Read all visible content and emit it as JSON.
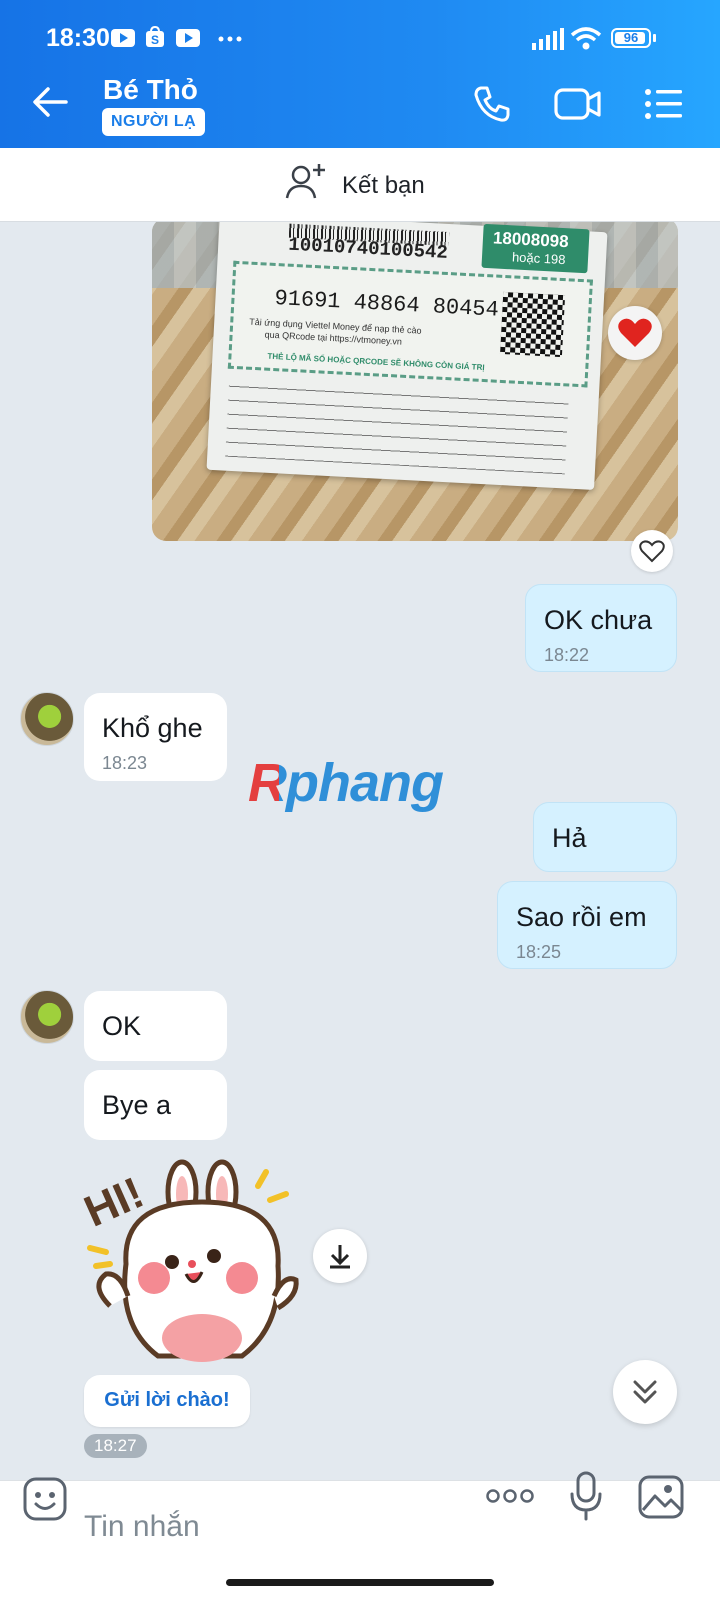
{
  "status_bar": {
    "time": "18:30",
    "battery": "96",
    "icons": [
      "youtube-icon",
      "shopee-icon",
      "youtube-icon",
      "more-dots-icon",
      "signal-icon",
      "wifi-icon",
      "battery-icon"
    ]
  },
  "header": {
    "title": "Bé Thỏ",
    "badge": "NGƯỜI LẠ",
    "icons": [
      "back-arrow-icon",
      "phone-icon",
      "video-call-icon",
      "menu-list-icon"
    ]
  },
  "friend_bar": {
    "label": "Kết bạn",
    "icon": "add-friend-icon"
  },
  "watermark": {
    "text": "Rphang"
  },
  "card_photo": {
    "barcode_number": "10010740100542",
    "hotline": "18008098",
    "hotline_alt": "hoặc 198",
    "code": "91691 48864 80454",
    "app_line": "Tải ứng dụng Viettel Money để nạp thẻ cào",
    "qr_line": "qua QRcode tại https://vtmoney.vn",
    "warning": "THẺ LỘ MÃ SỐ HOẶC QRCODE SẼ KHÔNG CÒN GIÁ TRỊ",
    "reaction": "heart"
  },
  "messages": [
    {
      "side": "me",
      "text": "OK chưa",
      "time": "18:22"
    },
    {
      "side": "them",
      "text": "Khổ ghe",
      "time": "18:23"
    },
    {
      "side": "me",
      "text": "Hả",
      "time": ""
    },
    {
      "side": "me",
      "text": "Sao rồi em",
      "time": "18:25"
    },
    {
      "side": "them",
      "text": "OK",
      "time": ""
    },
    {
      "side": "them",
      "text": "Bye a",
      "time": ""
    }
  ],
  "sticker": {
    "text": "HI!",
    "icon": "bunny-sticker"
  },
  "greeting_button": "Gửi lời chào!",
  "last_time": "18:27",
  "input": {
    "placeholder": "Tin nhắn",
    "icons": [
      "emoji-icon",
      "more-options-icon",
      "microphone-icon",
      "image-icon"
    ]
  },
  "colors": {
    "header_blue": "#1a7ee9",
    "my_bubble": "#d5f1ff",
    "their_bubble": "#ffffff",
    "chat_bg": "#e3e9ef"
  }
}
